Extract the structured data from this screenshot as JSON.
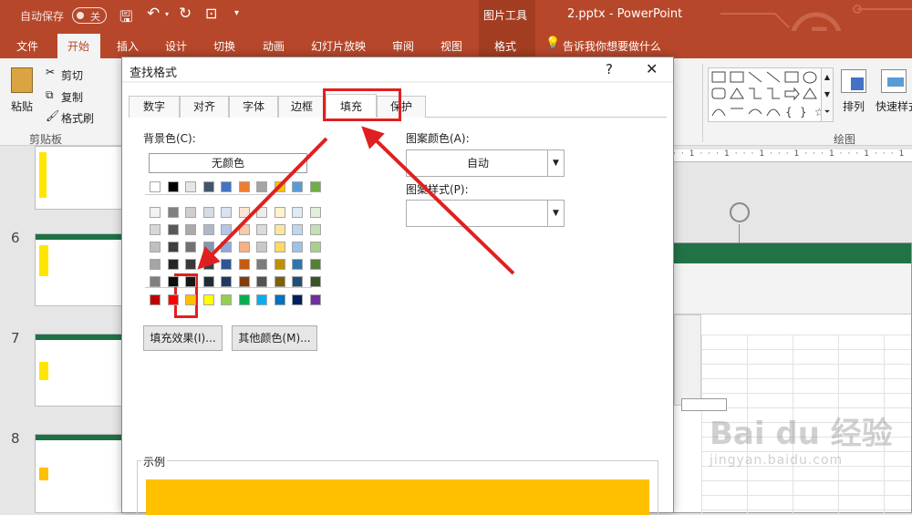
{
  "titlebar": {
    "autosave_label": "自动保存",
    "autosave_state": "关",
    "context_tab": "图片工具",
    "doc_title": "2.pptx - PowerPoint"
  },
  "ribbon_tabs": [
    "文件",
    "开始",
    "插入",
    "设计",
    "切换",
    "动画",
    "幻灯片放映",
    "审阅",
    "视图",
    "格式"
  ],
  "tell_me": "告诉我你想要做什么",
  "clipboard": {
    "cut": "剪切",
    "copy": "复制",
    "format_painter": "格式刷",
    "paste": "粘贴",
    "group_label": "剪贴板"
  },
  "drawing": {
    "arrange": "排列",
    "quick_styles": "快速样式",
    "group_label": "绘图"
  },
  "slide_numbers": [
    "6",
    "7",
    "8"
  ],
  "dialog": {
    "title": "查找格式",
    "help": "?",
    "close": "✕",
    "tabs": [
      "数字",
      "对齐",
      "字体",
      "边框",
      "填充",
      "保护"
    ],
    "active_tab": "填充",
    "bg_color_label": "背景色(C):",
    "no_color": "无颜色",
    "pattern_color_label": "图案颜色(A):",
    "pattern_color_value": "自动",
    "pattern_style_label": "图案样式(P):",
    "pattern_style_value": "",
    "fill_effects": "填充效果(I)...",
    "more_colors": "其他颜色(M)...",
    "sample_label": "示例",
    "sample_color": "#ffc000",
    "palette_row1": [
      "#ffffff",
      "#000000",
      "#e7e6e6",
      "#44546a",
      "#4472c4",
      "#ed7d31",
      "#a5a5a5",
      "#ffc000",
      "#5b9bd5",
      "#70ad47"
    ],
    "palette_tints": [
      [
        "#f2f2f2",
        "#808080",
        "#d0cece",
        "#d6dce4",
        "#d9e2f3",
        "#fbe5d5",
        "#ededed",
        "#fff2cc",
        "#deebf6",
        "#e2efd9"
      ],
      [
        "#d8d8d8",
        "#595959",
        "#aeaaaa",
        "#adb9ca",
        "#b4c6e7",
        "#f7cbac",
        "#dbdbdb",
        "#ffe599",
        "#bdd7ee",
        "#c5e0b3"
      ],
      [
        "#bfbfbf",
        "#3f3f3f",
        "#757070",
        "#8496b0",
        "#8eaadb",
        "#f4b183",
        "#c9c9c9",
        "#ffd965",
        "#9cc3e5",
        "#a8d08d"
      ],
      [
        "#a5a5a5",
        "#262626",
        "#3a3838",
        "#323f4f",
        "#2f5496",
        "#c55a11",
        "#7b7b7b",
        "#bf9000",
        "#2e75b5",
        "#538135"
      ],
      [
        "#7f7f7f",
        "#0c0c0c",
        "#171616",
        "#222a35",
        "#1f3864",
        "#833c0b",
        "#525252",
        "#7f6000",
        "#1e4e79",
        "#375623"
      ]
    ],
    "palette_standard": [
      "#c00000",
      "#ff0000",
      "#ffc000",
      "#ffff00",
      "#92d050",
      "#00b050",
      "#00b0f0",
      "#0070c0",
      "#002060",
      "#7030a0"
    ]
  },
  "watermark": {
    "brand": "Bai du 经验",
    "url": "jingyan.baidu.com"
  }
}
